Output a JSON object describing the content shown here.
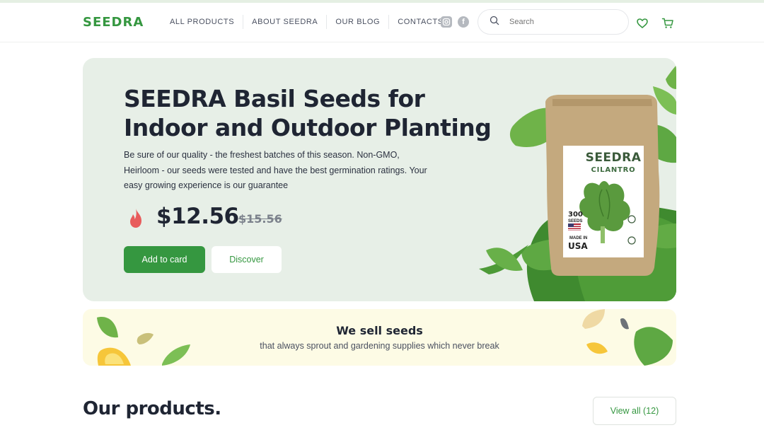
{
  "header": {
    "logo": "SEEDRA",
    "nav": [
      "ALL PRODUCTS",
      "ABOUT SEEDRA",
      "OUR BLOG",
      "CONTACTS"
    ],
    "social_icons": [
      "instagram-icon",
      "facebook-icon"
    ],
    "facebook_glyph": "f",
    "search": {
      "placeholder": "Search",
      "icon": "search-icon"
    },
    "actions": [
      "heart-icon",
      "cart-icon"
    ]
  },
  "hero": {
    "title": "SEEDRA Basil Seeds for Indoor and Outdoor Planting",
    "description": "Be sure of our quality - the freshest batches of this season. Non-GMO, Heirloom - our seeds were tested and have the best germination ratings. Your easy growing experience is our guarantee",
    "price": "$12.56",
    "old_price": "$15.56",
    "add_button": "Add to card",
    "discover_button": "Discover",
    "product_label": {
      "brand": "SEEDRA",
      "variety": "CILANTRO",
      "count": "300",
      "count_unit": "SEEDS",
      "made_in": "MADE IN",
      "origin": "USA"
    }
  },
  "banner": {
    "title": "We sell seeds",
    "subtitle": "that always sprout and gardening supplies which never break"
  },
  "products": {
    "title": "Our products.",
    "view_all": "View all (12)"
  },
  "colors": {
    "brand_green": "#359740",
    "hero_bg": "#e7efe7",
    "banner_bg": "#fdfbe5",
    "flame": "#e85c5c"
  }
}
